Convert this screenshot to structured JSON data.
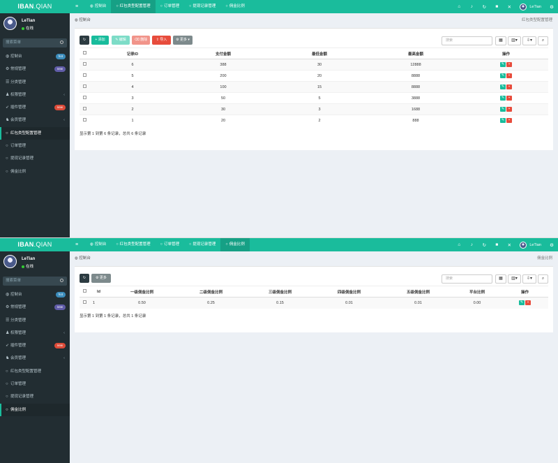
{
  "app": {
    "logo_bold": "IBAN",
    "logo_light": ".QIAN"
  },
  "colors": {
    "brand": "#1abc9c",
    "sidebar": "#222d32",
    "danger": "#e74c3c"
  },
  "user": {
    "name": "LeTian",
    "status": "在线"
  },
  "sidebar": {
    "search_placeholder": "搜索菜单",
    "badges": {
      "dashboard": "hot",
      "general": "new",
      "plugin": "new"
    },
    "items": [
      {
        "label": "控制台",
        "icon": "dashboard-icon"
      },
      {
        "label": "常规管理",
        "icon": "cogs-icon"
      },
      {
        "label": "分类管理",
        "icon": "list-icon"
      },
      {
        "label": "权限管理",
        "icon": "group-icon"
      },
      {
        "label": "插件管理",
        "icon": "rocket-icon"
      },
      {
        "label": "会员管理",
        "icon": "users-icon"
      },
      {
        "label": "红包类型配置管理",
        "icon": "circle-icon"
      },
      {
        "label": "订单管理",
        "icon": "circle-icon"
      },
      {
        "label": "提现记录管理",
        "icon": "circle-icon"
      },
      {
        "label": "佣金比例",
        "icon": "circle-icon"
      }
    ]
  },
  "header": {
    "tabs": [
      "控制台",
      "红包类型配置管理",
      "订单管理",
      "提现记录管理",
      "佣金比例"
    ],
    "username": "LeTian"
  },
  "screen1": {
    "breadcrumb_left": "控制台",
    "breadcrumb_right": "红包类型配置管理",
    "toolbar": {
      "add": "添加",
      "edit": "编辑",
      "delete": "删除",
      "import": "导入",
      "more": "更多",
      "search_placeholder": "搜索"
    },
    "table": {
      "headers": [
        "记录ID",
        "支付金额",
        "最低金额",
        "最高金额",
        "操作"
      ],
      "rows": [
        [
          "6",
          "388",
          "30",
          "12888"
        ],
        [
          "5",
          "200",
          "20",
          "8888"
        ],
        [
          "4",
          "100",
          "15",
          "8888"
        ],
        [
          "3",
          "50",
          "5",
          "3888"
        ],
        [
          "2",
          "30",
          "3",
          "1688"
        ],
        [
          "1",
          "20",
          "2",
          "888"
        ]
      ]
    },
    "pagination": "显示第 1 到第 6 条记录，总共 6 条记录"
  },
  "screen2": {
    "breadcrumb_left": "控制台",
    "breadcrumb_right": "佣金比例",
    "toolbar": {
      "more": "更多",
      "search_placeholder": "搜索"
    },
    "table": {
      "headers": [
        "Id",
        "一级佣金比例",
        "二级佣金比例",
        "三级佣金比例",
        "四级佣金比例",
        "五级佣金比例",
        "平台比例",
        "操作"
      ],
      "rows": [
        [
          "1",
          "0.50",
          "0.25",
          "0.15",
          "0.01",
          "0.01",
          "0.00"
        ]
      ]
    },
    "pagination": "显示第 1 到第 1 条记录，总共 1 条记录"
  }
}
